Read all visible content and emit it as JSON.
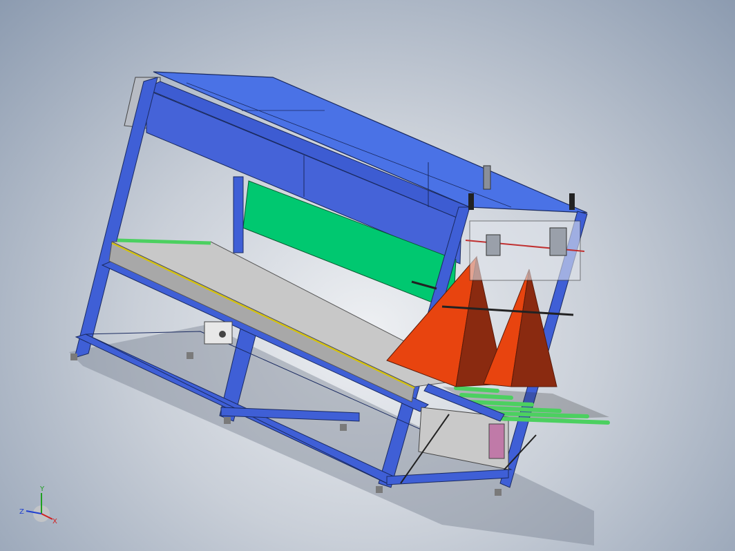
{
  "viewport": {
    "background_center": "#eef0f3",
    "background_edge": "#8c9bb0"
  },
  "model": {
    "frame_color": "#3f5fd6",
    "top_panel_color": "#4a72e6",
    "green_panel_color": "#00c870",
    "cone_color": "#e8440f",
    "cone_dark": "#8a2a10",
    "roller_color": "#4cd060",
    "table_color": "#c8c8c8",
    "guide_color": "#d8c400"
  },
  "triad": {
    "x_label": "X",
    "y_label": "Y",
    "z_label": "Z",
    "x_color": "#d02020",
    "y_color": "#20a020",
    "z_color": "#2040d0"
  }
}
